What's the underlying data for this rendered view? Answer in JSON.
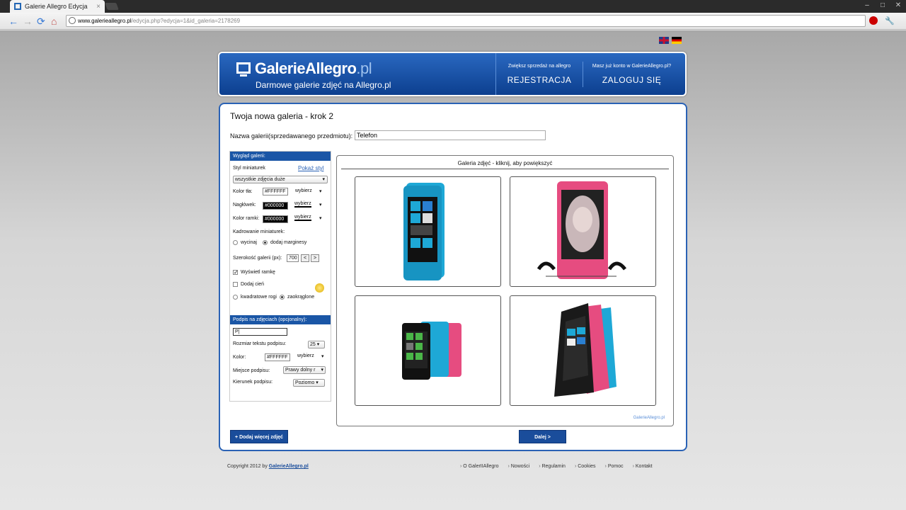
{
  "browser": {
    "tab_title": "Galerie Allegro Edycja",
    "tab_close": "×",
    "url_host": "www.galerieallegro.pl",
    "url_path": "/edycja.php?edycja=1&id_galeria=2178269",
    "win_minimize": "–",
    "win_maximize": "□",
    "win_close": "✕",
    "star": "☆",
    "wrench": "🔧",
    "back": "←",
    "forward": "→",
    "reload": "⟳",
    "home": "⌂"
  },
  "header": {
    "logo_main": "GalerieAllegro",
    "logo_suffix": ".pl",
    "tagline": "Darmowe galerie zdjęć na Allegro.pl",
    "register_small": "Zwiększ sprzedaż na allegro",
    "register_label": "REJESTRACJA",
    "login_small": "Masz już konto w GalerieAllegro.pl?",
    "login_label": "ZALOGUJ SIĘ"
  },
  "form": {
    "step_title": "Twoja nowa galeria - krok 2",
    "name_label": "Nazwa galerii(sprzedawanego przedmiotu):",
    "name_value": "Telefon"
  },
  "sidebar": {
    "section1_title": "Wygląd galerii:",
    "thumb_style_label": "Styl miniaturek",
    "show_style_link": "Pokaż styl",
    "thumb_style_value": "wszystkie zdjęcia duże",
    "bg_color_label": "Kolor tła:",
    "bg_color_value": "#FFFFFF",
    "header_label": "Nagłówek:",
    "header_value": "#000000",
    "frame_label": "Kolor ramki:",
    "frame_value": "#000000",
    "choose": "wybierz",
    "arrow": "▾",
    "crop_label": "Kadrowanie miniaturek:",
    "crop_cut": "wycinaj",
    "crop_margins": "dodaj marginesy",
    "width_label": "Szerokość galerii (px):",
    "width_value": "700",
    "prev": "<",
    "next": ">",
    "show_frame": "Wyświetl ramkę",
    "add_shadow": "Dodaj cień",
    "square_corners": "kwadratowe rogi",
    "rounded": "zaokrąglone",
    "section2_title": "Podpis na zdjęciach (opcjonalny):",
    "caption_value": "P|",
    "text_size_label": "Rozmiar tekstu podpisu:",
    "text_size_value": "25",
    "color_label": "Kolor:",
    "color_value": "#FFFFFF",
    "place_label": "Miejsce podpisu:",
    "place_value": "Prawy dolny r",
    "direction_label": "Kierunek podpisu:",
    "direction_value": "Poziomo"
  },
  "gallery": {
    "title": "Galeria zdjęć - kliknij, aby powiększyć",
    "credit": "GalerieAllegro.pl"
  },
  "buttons": {
    "add_more": "+ Dodaj więcej zdjęć",
    "next": "Dalej >"
  },
  "footer": {
    "copyright": "Copyright 2012 by",
    "brand": "GalerieAllegro.pl",
    "links": [
      "O GalerIIAllegro",
      "Nowości",
      "Regulamin",
      "Cookies",
      "Pomoc",
      "Kontakt"
    ]
  }
}
